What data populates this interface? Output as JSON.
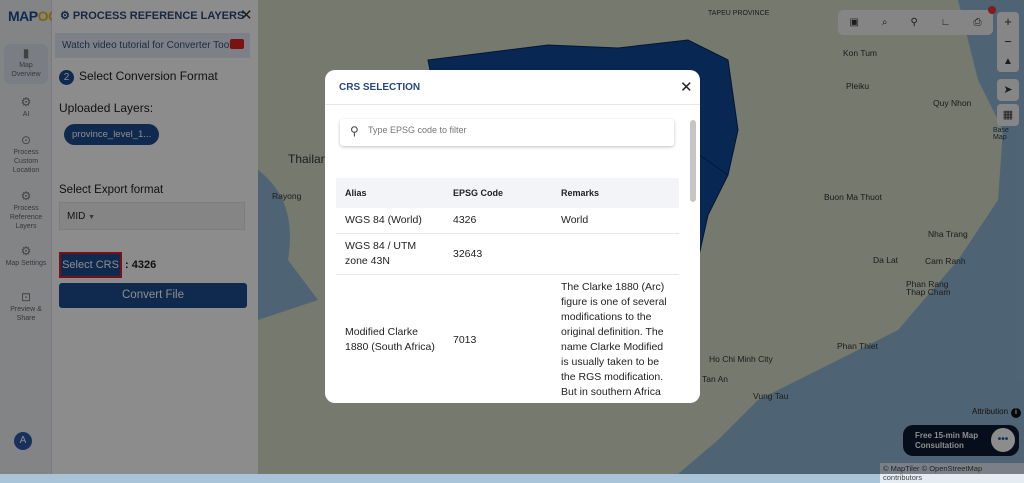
{
  "app": {
    "logo_left": "MAP",
    "logo_right": "OG"
  },
  "rail": [
    {
      "label": "Map Overview",
      "icon": "map-icon"
    },
    {
      "label": "AI",
      "icon": "gear-icon"
    },
    {
      "label": "Process Custom Location",
      "icon": "pin-icon"
    },
    {
      "label": "Process Reference Layers",
      "icon": "gear-icon"
    },
    {
      "label": "Map Settings",
      "icon": "gear-icon"
    },
    {
      "label": "Preview & Share",
      "icon": "share-icon"
    }
  ],
  "avatar": "A",
  "panel": {
    "title": "PROCESS REFERENCE LAYERS",
    "video": "Watch video tutorial for Converter Tool",
    "step_number": "2",
    "step_label": "Select Conversion Format",
    "uploaded_label": "Uploaded Layers:",
    "layer_chip": "province_level_1...",
    "format_label": "Select Export format",
    "format_value": "MID",
    "select_crs": "Select CRS",
    "crs_value": ": 4326",
    "convert": "Convert File"
  },
  "map": {
    "labels": [
      "Thailand",
      "Rayong",
      "TAPEU PROVINCE",
      "Kon Tum",
      "Pleiku",
      "Quy Nhon",
      "Buon Ma Thuot",
      "Nha Trang",
      "Da Lat",
      "Cam Ranh",
      "Phan Rang Thap Cham",
      "Phan Thiet",
      "Ho Chi Minh City",
      "Tan An",
      "Vung Tau"
    ],
    "base_map": "Base Map",
    "attribution": "Attribution",
    "consult": "Free 15-min Map Consultation",
    "credits": "© MapTiler © OpenStreetMap contributors",
    "colors": {
      "land": "#d8dcc6",
      "sea": "#8fb6d3",
      "province": "#0f4a98"
    }
  },
  "modal": {
    "title": "CRS SELECTION",
    "search_placeholder": "Type EPSG code to filter",
    "columns": [
      "Alias",
      "EPSG Code",
      "Remarks"
    ],
    "rows": [
      {
        "alias": "WGS 84 (World)",
        "code": "4326",
        "remarks": "World"
      },
      {
        "alias": "WGS 84 / UTM zone 43N",
        "code": "32643",
        "remarks": ""
      },
      {
        "alias": "Modified Clarke 1880 (South Africa)",
        "code": "7013",
        "remarks": "The Clarke 1880 (Arc) figure is one of several modifications to the original definition. The name Clarke Modified is usually taken to be the RGS modification. But in southern Africa"
      }
    ]
  }
}
